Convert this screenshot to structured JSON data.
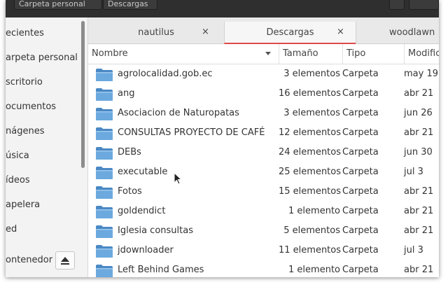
{
  "header": {
    "path_buttons": [
      "Carpeta personal",
      "Descargas"
    ]
  },
  "sidebar": {
    "items": [
      "ecientes",
      "arpeta personal",
      "scritorio",
      "ocumentos",
      "nágenes",
      "úsica",
      "ídeos",
      "apelera",
      "ed",
      "ontenedor"
    ],
    "eject_icon": "eject-icon"
  },
  "tabs": [
    {
      "label": "nautilus",
      "close": "×"
    },
    {
      "label": "Descargas",
      "close": "×"
    },
    {
      "label": "woodlawn"
    }
  ],
  "columns": {
    "name": "Nombre",
    "size": "Tamaño",
    "type": "Tipo",
    "modified": "Modifica"
  },
  "rows": [
    {
      "name": "agrolocalidad.gob.ec",
      "size": "3 elementos",
      "type": "Carpeta",
      "modified": "may 19"
    },
    {
      "name": "ang",
      "size": "16 elementos",
      "type": "Carpeta",
      "modified": "abr 21"
    },
    {
      "name": "Asociacion de Naturopatas",
      "size": "3 elementos",
      "type": "Carpeta",
      "modified": "jun 26"
    },
    {
      "name": "CONSULTAS PROYECTO DE CAFÉ",
      "size": "12 elementos",
      "type": "Carpeta",
      "modified": "abr 21"
    },
    {
      "name": "DEBs",
      "size": "24 elementos",
      "type": "Carpeta",
      "modified": "jun 30"
    },
    {
      "name": "executable",
      "size": "25 elementos",
      "type": "Carpeta",
      "modified": "jul 3"
    },
    {
      "name": "Fotos",
      "size": "15 elementos",
      "type": "Carpeta",
      "modified": "abr 21"
    },
    {
      "name": "goldendict",
      "size": "1 elemento",
      "type": "Carpeta",
      "modified": "abr 21"
    },
    {
      "name": "Iglesia consultas",
      "size": "5 elementos",
      "type": "Carpeta",
      "modified": "abr 21"
    },
    {
      "name": "jdownloader",
      "size": "11 elementos",
      "type": "Carpeta",
      "modified": "jul 3"
    },
    {
      "name": "Left Behind Games",
      "size": "1 elemento",
      "type": "Carpeta",
      "modified": "abr 21"
    }
  ],
  "colors": {
    "accent": "#e24949",
    "folder": "#5e9fd6",
    "headerbar": "#2f2f2f"
  }
}
